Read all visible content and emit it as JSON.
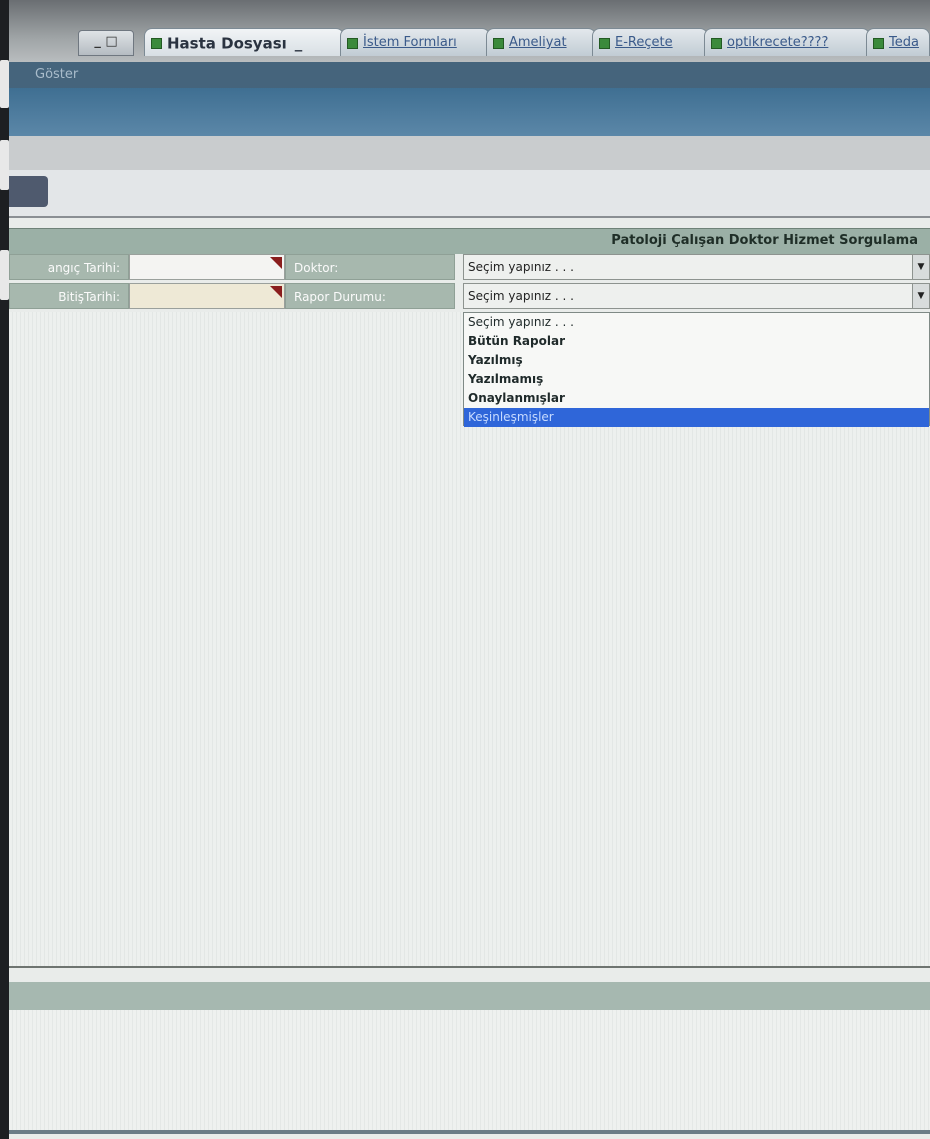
{
  "window": {
    "controls": "_ □",
    "header_title": "Göster",
    "header_banner": "",
    "tabs": [
      {
        "label": "Hasta Dosyası",
        "active": true,
        "close": "_"
      },
      {
        "label": "İstem Formları",
        "active": false
      },
      {
        "label": "Ameliyat",
        "active": false
      },
      {
        "label": "E-Reçete",
        "active": false
      },
      {
        "label": "optikrecete????",
        "active": false
      },
      {
        "label": "Teda",
        "active": false
      }
    ]
  },
  "form": {
    "title": "Patoloji Çalışan Doktor Hizmet Sorgulama",
    "start_date_label": "angıç Tarihi:",
    "end_date_label": "BitişTarihi:",
    "start_date_value": "",
    "end_date_value": "",
    "doctor_label": "Doktor:",
    "doctor_value": "Seçim yapınız . . .",
    "report_status_label": "Rapor Durumu:",
    "report_status_value": "Seçim yapınız . . .",
    "report_status_options": [
      "Seçim yapınız . . .",
      "Bütün Rapolar",
      "Yazılmış",
      "Yazılmamış",
      "Onaylanmışlar",
      "Keşinleşmişler"
    ],
    "highlighted_option": "Keşinleşmişler"
  },
  "colors": {
    "header_blue": "#45647c",
    "label_green": "#a7b8ae",
    "selection_blue": "#2f66d9"
  },
  "icons": [
    "tab-document-icon",
    "dropdown-arrow-icon",
    "date-picker-corner-icon"
  ]
}
